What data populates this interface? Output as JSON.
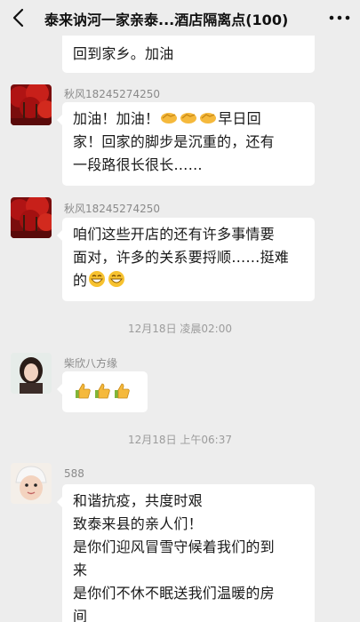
{
  "header": {
    "title": "泰来讷河一家亲泰...酒店隔离点(100)",
    "back_icon": "back-chevron-icon",
    "more_icon": "more-dots-icon"
  },
  "messages": [
    {
      "id": "m0",
      "lines": [
        "回到家乡。加油"
      ]
    },
    {
      "id": "m1",
      "sender": "秋风18245274250",
      "line1_prefix": "加油！加油！",
      "line1_emojis": [
        "handshake-emoji",
        "handshake-emoji",
        "handshake-emoji"
      ],
      "line1_suffix": "早日回",
      "lines": [
        "家！回家的脚步是沉重的，还有",
        "一段路很长很长……"
      ]
    },
    {
      "id": "m2",
      "sender": "秋风18245274250",
      "lines": [
        "咱们这些开店的还有许多事情要",
        "面对，许多的关系要捋顺……挺难"
      ],
      "last_prefix": "的",
      "last_emojis": [
        "grinning-emoji",
        "grinning-emoji"
      ]
    },
    {
      "id": "m3",
      "sender": "柴欣八方缘",
      "emojis": [
        "thumbs-up-emoji",
        "thumbs-up-emoji",
        "thumbs-up-emoji"
      ]
    },
    {
      "id": "m4",
      "sender": "588",
      "lines": [
        "和谐抗疫，共度时艰",
        "致泰来县的亲人们！",
        "是你们迎风冒雪守候着我们的到",
        "来",
        "是你们不休不眠送我们温暖的房",
        "间"
      ]
    }
  ],
  "timestamps": [
    "12月18日 凌晨02:00",
    "12月18日 上午06:37"
  ]
}
